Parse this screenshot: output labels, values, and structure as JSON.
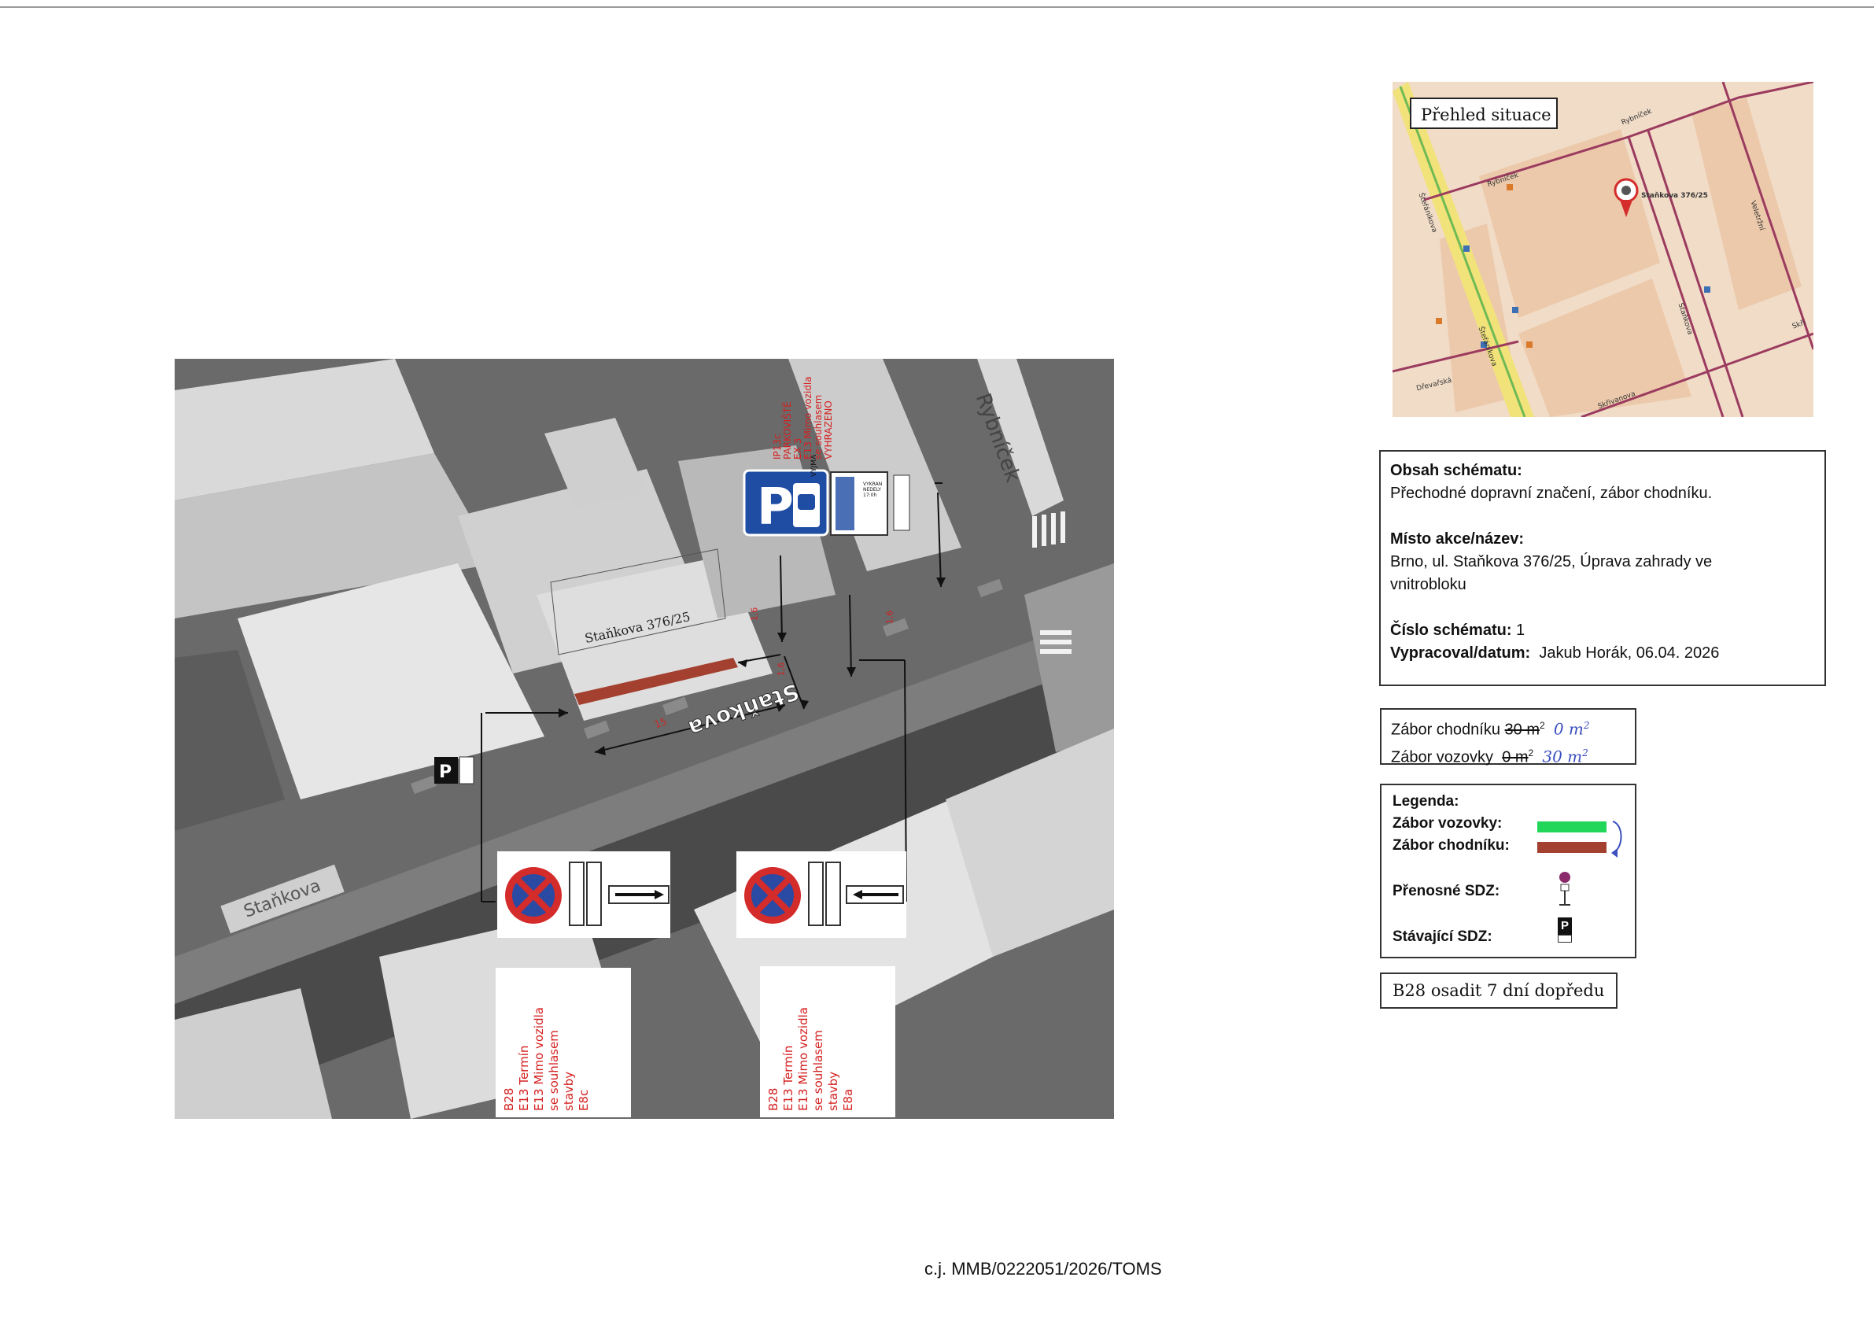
{
  "aerial": {
    "street_label_left": "Staňkova",
    "street_label_right": "Rybníček",
    "road_label": "Staňkova",
    "building_label": "Staňkova 376/25",
    "dimensions": {
      "d1": "1,6",
      "d2": "1,6",
      "d3": "1,6",
      "d4": "15"
    },
    "top_sign_note": "IP13c\nPARKOVIŠTĚ\nEX 3\nE13 Mimo vozidla\nse souhlasem\nVYHRAZENO",
    "sign_vyjma_text": "VYJMA",
    "sign_panel_text": "VYKRAN\nNEDELY\n17:0h",
    "existing_sign_letter": "P",
    "note_left": "B28\nE13 Termín\nE13 Mimo vozidla\nse souhlasem\nstavby\nE8c",
    "note_right": "B28\nE13 Termín\nE13 Mimo vozidla\nse souhlasem\nstavby\nE8a"
  },
  "map": {
    "title": "Přehled situace",
    "address_label": "Staňkova 376/25",
    "streets": [
      "Rybníček",
      "Rybníček",
      "Štefánikova",
      "Štefánikova",
      "Staňkova",
      "Dřevařská",
      "Skřivanova",
      "Veletržní",
      "Skři"
    ]
  },
  "info": {
    "content_label": "Obsah schématu:",
    "content_text": "Přechodné dopravní značení, zábor chodníku.",
    "place_label": "Místo akce/název:",
    "place_text_1": "Brno, ul. Staňkova 376/25, Úprava zahrady ve",
    "place_text_2": "vnitrobloku",
    "number_label": "Číslo schématu:",
    "number_value": "1",
    "author_label": "Vypracoval/datum:",
    "author_value": "Jakub Horák, 06.04. 2026"
  },
  "area": {
    "sidewalk_label": "Zábor chodníku",
    "sidewalk_value": "30 m",
    "sidewalk_hand": "0 m",
    "road_label": "Zábor vozovky",
    "road_value": "0 m",
    "road_hand": "30 m",
    "sup": "2"
  },
  "legend": {
    "title": "Legenda:",
    "road": "Zábor vozovky:",
    "sidewalk": "Zábor chodníku:",
    "portable": "Přenosné SDZ:",
    "existing": "Stávající SDZ:",
    "existing_letter": "P",
    "colors": {
      "road": "#22d65a",
      "sidewalk": "#a3402f"
    }
  },
  "b28_note": "B28 osadit 7 dní dopředu",
  "footer": "c.j. MMB/0222051/2026/TOMS"
}
